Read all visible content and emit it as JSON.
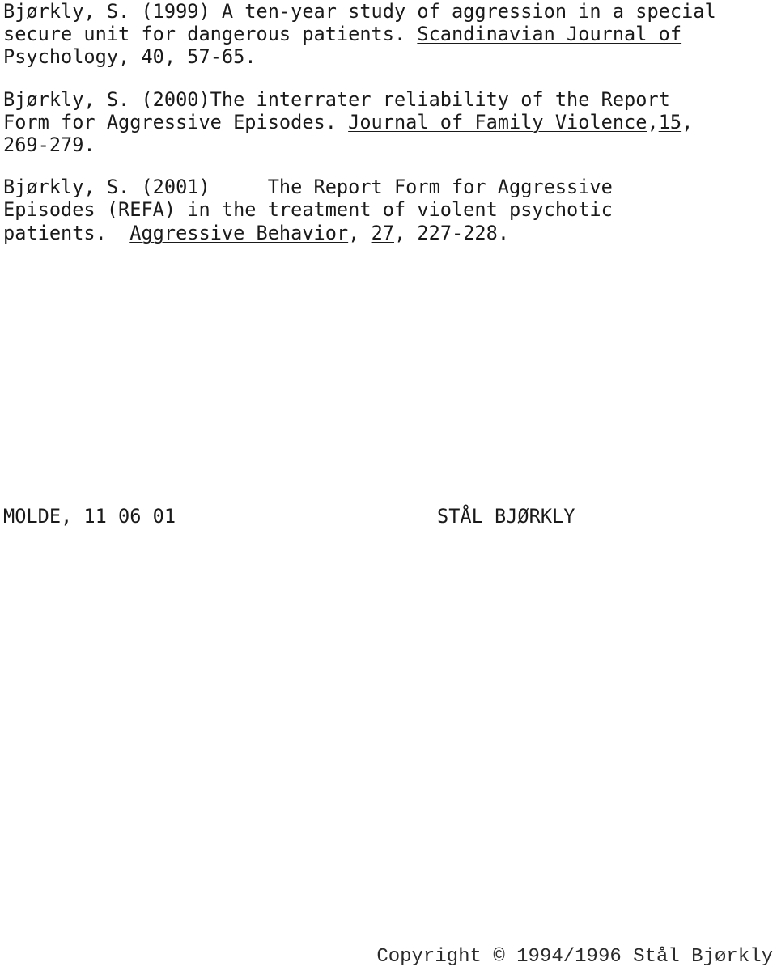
{
  "document": {
    "background_color": "#ffffff",
    "text_color": "#1a1a1a"
  },
  "references": [
    {
      "id": "bjorkly-1999",
      "lines": [
        [
          {
            "text": "Bjørkly, S. (1999) A ten-year study of aggression in a special",
            "underline": false
          }
        ],
        [
          {
            "text": "secure unit for dangerous patients. ",
            "underline": false
          },
          {
            "text": "Scandinavian Journal of",
            "underline": true
          }
        ],
        [
          {
            "text": "Psychology",
            "underline": true
          },
          {
            "text": ", ",
            "underline": false
          },
          {
            "text": "40",
            "underline": true
          },
          {
            "text": ", 57-65.",
            "underline": false
          }
        ]
      ]
    },
    {
      "id": "bjorkly-2000",
      "lines": [
        [
          {
            "text": "Bjørkly, S. (2000)The interrater reliability of the Report",
            "underline": false
          }
        ],
        [
          {
            "text": "Form for Aggressive Episodes. ",
            "underline": false
          },
          {
            "text": "Journal of Family Violence",
            "underline": true
          },
          {
            "text": ",",
            "underline": false
          },
          {
            "text": "15",
            "underline": true
          },
          {
            "text": ",",
            "underline": false
          }
        ],
        [
          {
            "text": "269-279.",
            "underline": false
          }
        ]
      ]
    },
    {
      "id": "bjorkly-2001",
      "lines": [
        [
          {
            "text": "Bjørkly, S. (2001)     The Report Form for Aggressive",
            "underline": false
          }
        ],
        [
          {
            "text": "Episodes (REFA) in the treatment of violent psychotic",
            "underline": false
          }
        ],
        [
          {
            "text": "patients.  ",
            "underline": false
          },
          {
            "text": "Aggressive Behavior",
            "underline": true
          },
          {
            "text": ", ",
            "underline": false
          },
          {
            "text": "27",
            "underline": true
          },
          {
            "text": ", 227-228.",
            "underline": false
          }
        ]
      ]
    }
  ],
  "signature": {
    "place_and_date": "MOLDE, 11 06 01",
    "author": "STÅL BJØRKLY"
  },
  "footer": {
    "copyright": "Copyright © 1994/1996 Stål Bjørkly"
  }
}
